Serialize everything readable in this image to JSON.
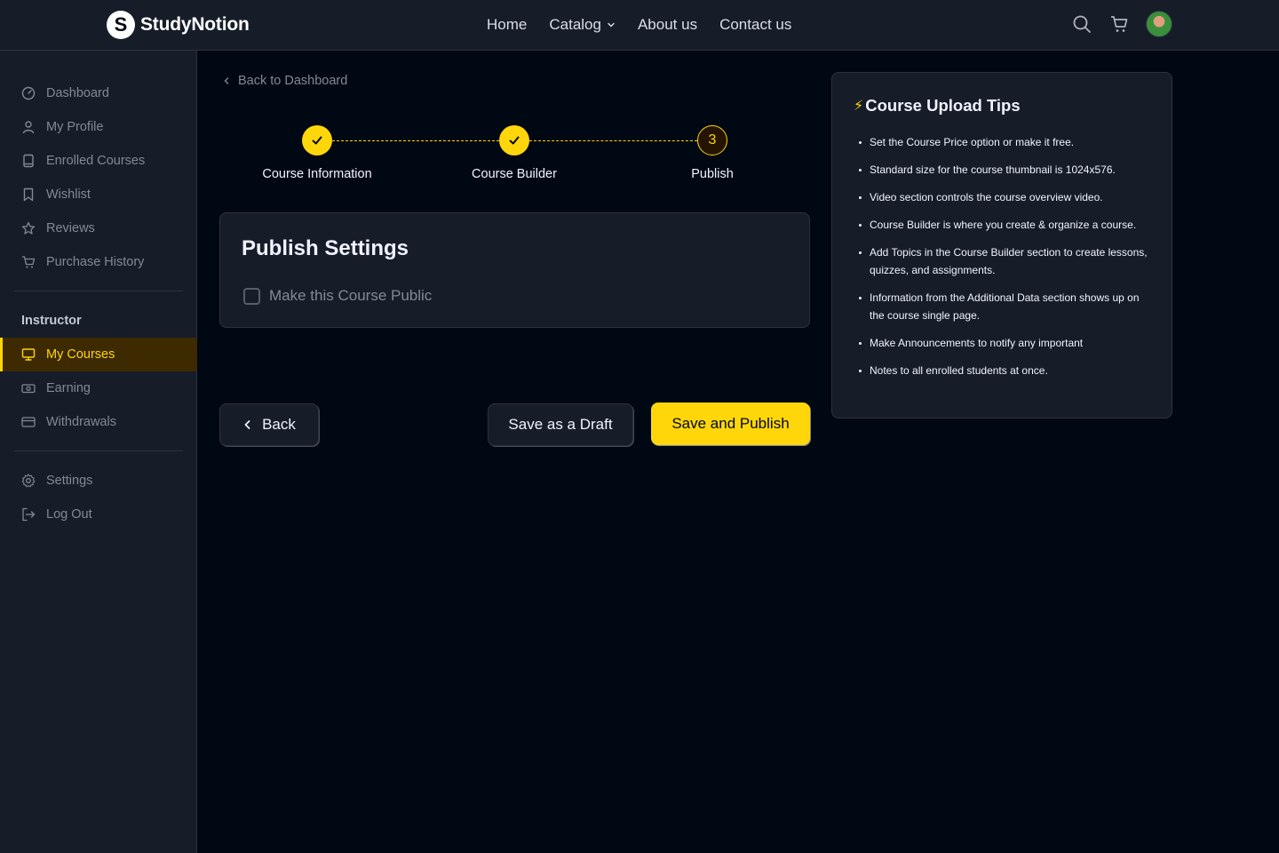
{
  "brand": {
    "logo_letter": "S",
    "name": "StudyNotion",
    "accent": "#FFD60A"
  },
  "nav": {
    "links": [
      {
        "label": "Home"
      },
      {
        "label": "Catalog"
      },
      {
        "label": "About us"
      },
      {
        "label": "Contact us"
      }
    ],
    "icons": [
      "search-icon",
      "cart-icon",
      "avatar"
    ]
  },
  "sidebar": {
    "items": [
      {
        "label": "Dashboard",
        "icon": "gauge-icon"
      },
      {
        "label": "My Profile",
        "icon": "user-icon"
      },
      {
        "label": "Enrolled Courses",
        "icon": "book-icon"
      },
      {
        "label": "Wishlist",
        "icon": "bookmark-icon"
      },
      {
        "label": "Reviews",
        "icon": "star-icon"
      },
      {
        "label": "Purchase History",
        "icon": "cart-icon"
      }
    ],
    "instructor_heading": "Instructor",
    "instructor_items": [
      {
        "label": "My Courses",
        "icon": "monitor-icon",
        "active": true
      },
      {
        "label": "Earning",
        "icon": "money-icon"
      },
      {
        "label": "Withdrawals",
        "icon": "card-icon"
      }
    ],
    "bottom_items": [
      {
        "label": "Settings",
        "icon": "gear-icon"
      },
      {
        "label": "Log Out",
        "icon": "logout-icon"
      }
    ]
  },
  "main": {
    "back_link": "Back to Dashboard",
    "steps": [
      {
        "label": "Course Information",
        "status": "done"
      },
      {
        "label": "Course Builder",
        "status": "done"
      },
      {
        "label": "Publish",
        "status": "current",
        "number": "3"
      }
    ],
    "publish": {
      "title": "Publish Settings",
      "checkbox_label": "Make this Course Public",
      "checked": false
    },
    "buttons": {
      "back": "Back",
      "draft": "Save as a Draft",
      "publish": "Save and Publish"
    }
  },
  "tips": {
    "icon": "⚡",
    "title": "Course Upload Tips",
    "items": [
      "Set the Course Price option or make it free.",
      "Standard size for the course thumbnail is 1024x576.",
      "Video section controls the course overview video.",
      "Course Builder is where you create & organize a course.",
      "Add Topics in the Course Builder section to create lessons, quizzes, and assignments.",
      "Information from the Additional Data section shows up on the course single page.",
      "Make Announcements to notify any important",
      "Notes to all enrolled students at once."
    ]
  }
}
